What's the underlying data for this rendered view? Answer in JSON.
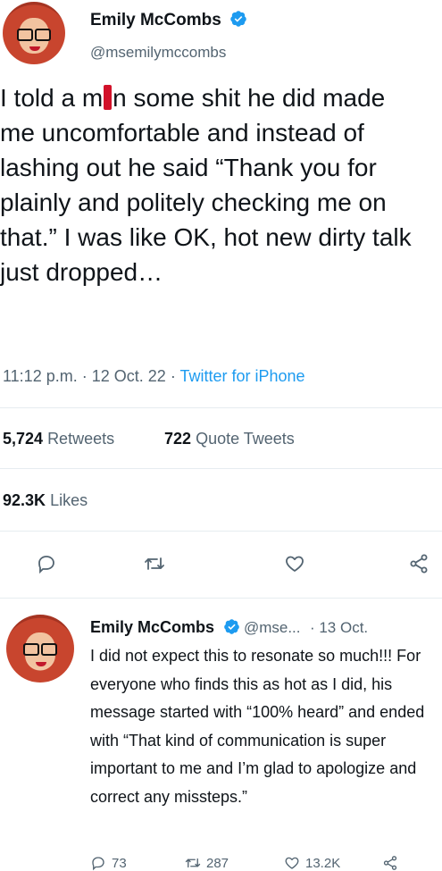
{
  "tweet": {
    "author_name": "Emily McCombs",
    "author_handle": "@msemilymccombs",
    "text_before_mark": "I told a m",
    "text_after_mark": "n some shit he did made me uncomfortable and instead of lashing out he said “Thank you for plainly and politely checking me on that.” I was like OK, hot new dirty talk just dropped…",
    "time": "11:12 p.m.",
    "date": "12 Oct. 22",
    "source": "Twitter for iPhone",
    "retweets_count": "5,724",
    "retweets_label": "Retweets",
    "quotes_count": "722",
    "quotes_label": "Quote Tweets",
    "likes_count": "92.3K",
    "likes_label": "Likes"
  },
  "reply": {
    "author_name": "Emily McCombs",
    "author_handle": "@mse...",
    "date": "· 13 Oct.",
    "text": "I did not expect this to resonate so much!!! For everyone who finds this as hot as I did, his message started with “100% heard” and ended with “That kind of communication is super important to me and I’m glad to apologize and correct any missteps.”",
    "reply_count": "73",
    "retweet_count": "287",
    "like_count": "13.2K"
  },
  "colors": {
    "accent": "#1d9bf0",
    "secondary_text": "#536471",
    "mark_red": "#d2122a"
  },
  "icons": [
    "verified-badge-icon",
    "reply-icon",
    "retweet-icon",
    "like-icon",
    "share-icon"
  ]
}
